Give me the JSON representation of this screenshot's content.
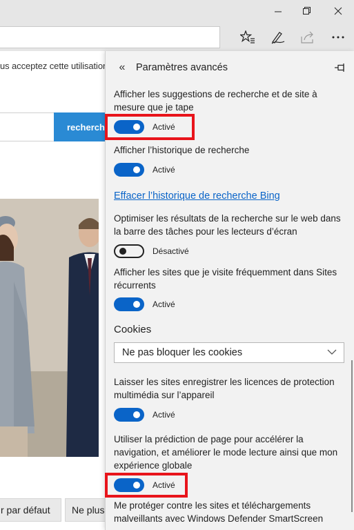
{
  "window": {
    "minimize_icon": "minimize-icon",
    "restore_icon": "restore-icon",
    "close_icon": "close-icon"
  },
  "toolbar": {
    "icons": [
      "favorites-star-icon",
      "pen-note-icon",
      "share-icon",
      "more-icon"
    ]
  },
  "page": {
    "cookie_notice": "us acceptez cette utilisation",
    "search_button": "recherche",
    "bottom_buttons": [
      "r par défaut",
      "Ne plus"
    ]
  },
  "panel": {
    "title": "Paramètres avancés",
    "settings": [
      {
        "label": "Afficher les suggestions de recherche et de site à mesure que je tape",
        "state": "Activé",
        "on": true
      },
      {
        "label": "Afficher l’historique de recherche",
        "state": "Activé",
        "on": true
      },
      {
        "label": "Optimiser les résultats de la recherche sur le web dans la barre des tâches pour les lecteurs d’écran",
        "state": "Désactivé",
        "on": false
      },
      {
        "label": "Afficher les sites que je visite fréquemment dans Sites récurrents",
        "state": "Activé",
        "on": true
      },
      {
        "label": "Laisser les sites enregistrer les licences de protection multimédia sur l’appareil",
        "state": "Activé",
        "on": true
      },
      {
        "label": "Utiliser la prédiction de page pour accélérer la navigation, et améliorer le mode lecture ainsi que mon expérience globale",
        "state": "Activé",
        "on": true
      },
      {
        "label": "Me protéger contre les sites et téléchargements malveillants avec Windows Defender SmartScreen"
      }
    ],
    "clear_history_link": "Effacer l’historique de recherche Bing",
    "cookies": {
      "heading": "Cookies",
      "selected": "Ne pas bloquer les cookies"
    }
  },
  "colors": {
    "toggle_on": "#0a64c8",
    "link": "#0a64c8",
    "highlight": "#e8141b",
    "search_button": "#2a8ad4"
  }
}
